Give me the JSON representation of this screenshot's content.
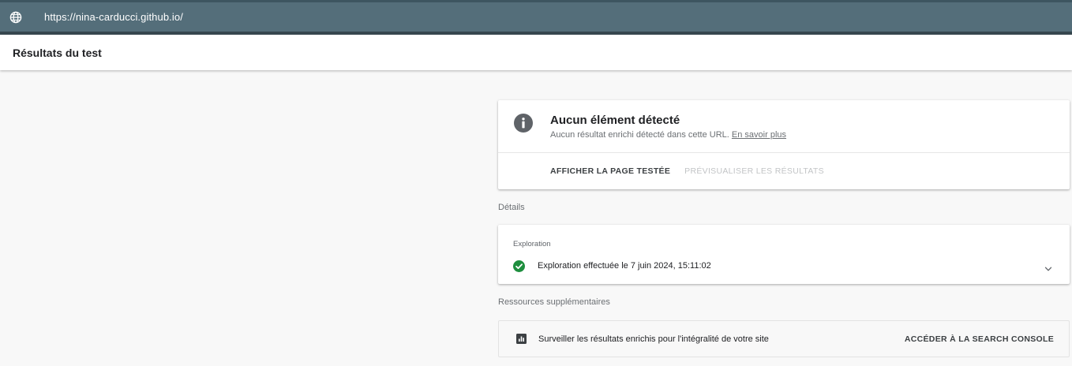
{
  "urlbar": {
    "icon": "globe-icon",
    "url": "https://nina-carducci.github.io/"
  },
  "header": {
    "title": "Résultats du test"
  },
  "result": {
    "icon": "info-icon",
    "title": "Aucun élément détecté",
    "subtitle": "Aucun résultat enrichi détecté dans cette URL.",
    "learn_more": "En savoir plus",
    "show_page_label": "AFFICHER LA PAGE TESTÉE",
    "preview_label": "PRÉVISUALISER LES RÉSULTATS"
  },
  "details": {
    "label": "Détails",
    "exploration": {
      "label": "Exploration",
      "icon": "check-circle-icon",
      "status": "Exploration effectuée le 7 juin 2024, 15:11:02",
      "expand_icon": "chevron-down-icon"
    }
  },
  "resources": {
    "label": "Ressources supplémentaires",
    "icon": "chart-icon",
    "text": "Surveiller les résultats enrichis pour l'intégralité de votre site",
    "action_label": "ACCÉDER À LA SEARCH CONSOLE"
  },
  "colors": {
    "urlbar_bg": "#546e7a",
    "success_green": "#1e8e3e",
    "info_gray": "#5f6368"
  }
}
